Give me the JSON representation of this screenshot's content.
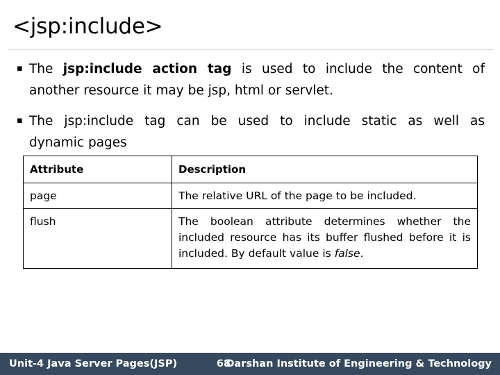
{
  "slide": {
    "title": "<jsp:include>",
    "bullet_marker": "▪",
    "bullets": [
      {
        "line1_pre": "The ",
        "line1_bold": "jsp:include  action  tag",
        "line1_post": " is  used  to  include  the  content  of",
        "line2": "another resource it may be jsp, html or servlet."
      },
      {
        "line1": "The  jsp:include  tag  can  be  used  to  include  static  as  well  as",
        "line2": "dynamic pages"
      }
    ],
    "table": {
      "headers": [
        "Attribute",
        "Description"
      ],
      "rows": [
        {
          "attribute": "page",
          "description_lines": [
            "The relative URL of the page to be included."
          ],
          "italic_tail": "",
          "tail_after_italic": ""
        },
        {
          "attribute": "flush",
          "description_lines": [
            "The  boolean  attribute  determines  whether  the",
            "included  resource  has  its  buffer  flushed  before  it  is",
            "included. By default value is "
          ],
          "italic_tail": "false",
          "tail_after_italic": "."
        }
      ]
    },
    "footer": {
      "left": "Unit-4 Java Server Pages(JSP)",
      "page_number": "68",
      "right": "Darshan Institute of Engineering & Technology",
      "background_color": "#36495e",
      "text_color": "#ffffff"
    }
  }
}
